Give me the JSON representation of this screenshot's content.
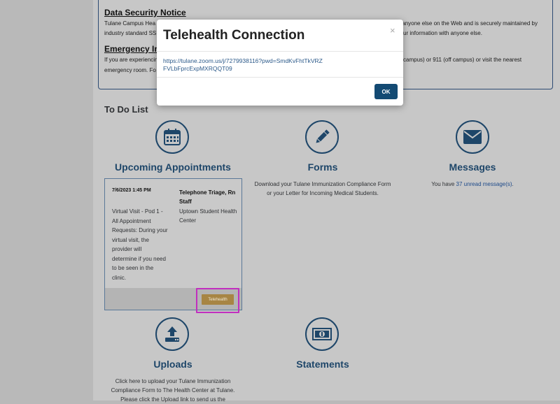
{
  "notice": {
    "security_heading": "Data Security Notice",
    "security_line1_left": "Tulane Campus Hea",
    "security_line1_right": "y anyone else on the Web and is securely maintained by",
    "security_line2_left": "industry standard SS",
    "security_line2_right": "ur information with anyone else.",
    "emergency_heading": "Emergency Ins",
    "emergency_line1_left": "If you are experiencin",
    "emergency_line1_right": "campus) or 911 (off campus) or visit the nearest",
    "emergency_line2_left": "emergency room. Fo"
  },
  "todo": {
    "title": "To Do List"
  },
  "sections": {
    "appointments": {
      "title": "Upcoming Appointments",
      "icon": "calendar-icon"
    },
    "forms": {
      "title": "Forms",
      "icon": "pencil-icon",
      "text": "Download your Tulane Immunization Compliance Form or your Letter for Incoming Medical Students."
    },
    "messages": {
      "title": "Messages",
      "icon": "envelope-icon",
      "text_prefix": "You have ",
      "link": "37 unread message(s)",
      "text_suffix": "."
    },
    "uploads": {
      "title": "Uploads",
      "icon": "upload-icon",
      "text_line1": "Click here to upload your Tulane Immunization",
      "text_line2": "Compliance Form to The Health Center at Tulane.",
      "text_line3": "Please click the Upload link to send us the"
    },
    "statements": {
      "title": "Statements",
      "icon": "money-icon"
    }
  },
  "appointment": {
    "date": "7/6/2023 1:45 PM",
    "type": "Telephone Triage, Rn Staff",
    "location": "Uptown Student Health Center",
    "description": "Virtual Visit - Pod 1 - All Appointment Requests: During your virtual visit, the provider will determine if you need to be seen in the clinic.",
    "telehealth_label": "Telehealth"
  },
  "modal": {
    "title": "Telehealth Connection",
    "close": "×",
    "link": "https://tulane.zoom.us/j/7279938116?pwd=SmdKvFhtTkVRZFVLbFprcExpMXRQQT09",
    "ok_label": "OK"
  },
  "colors": {
    "primary": "#1e4669",
    "telehealth_button": "#a78544",
    "highlight": "#c12fbf",
    "ok_button": "#134a73"
  }
}
